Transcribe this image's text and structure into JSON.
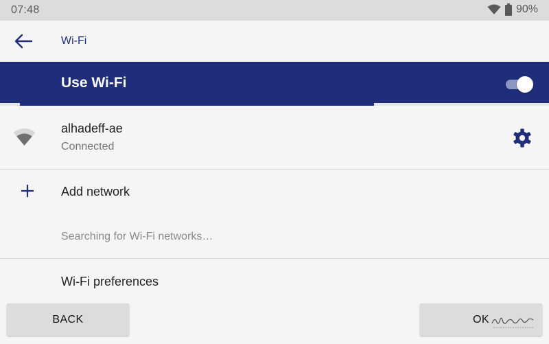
{
  "status_bar": {
    "time": "07:48",
    "battery": "90%"
  },
  "app_bar": {
    "title": "Wi-Fi"
  },
  "master_switch": {
    "label": "Use Wi-Fi",
    "state": "on"
  },
  "connected_network": {
    "name": "alhadeff-ae",
    "status": "Connected"
  },
  "add_network": {
    "label": "Add network"
  },
  "scan_status": "Searching for Wi-Fi networks…",
  "preferences": {
    "label": "Wi-Fi preferences"
  },
  "buttons": {
    "back_label": "BACK",
    "ok_label": "OK"
  },
  "colors": {
    "accent": "#1f2d7a",
    "status_bar": "#dcdcdc",
    "background": "#f5f5f5",
    "divider": "#d6d6d6"
  },
  "icons": {
    "status_wifi": "wifi-signal-icon",
    "status_battery": "battery-icon",
    "back": "arrow-left-icon",
    "network": "wifi-signal-icon",
    "settings": "gear-icon",
    "add": "plus-icon"
  }
}
